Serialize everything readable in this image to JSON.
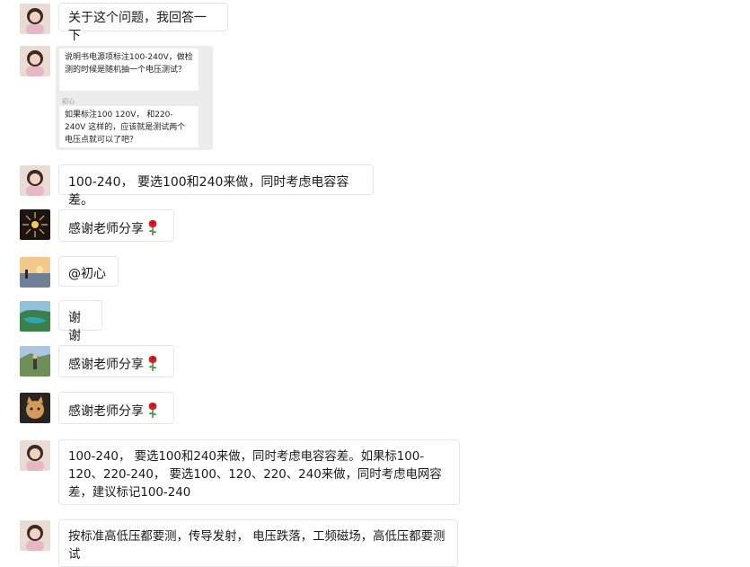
{
  "messages": [
    {
      "text": "关于这个问题，我回答一下"
    },
    {
      "quote": {
        "first": "说明书电源项标注100-240V，做检测的时候是随机抽一个电压测试？",
        "name": "初心",
        "second": "如果标注100 120V， 和220-240V 这样的，应该就是测试两个电压点就可以了吧？"
      }
    },
    {
      "text": "100-240， 要选100和240来做，同时考虑电容容差。"
    },
    {
      "text": "感谢老师分享"
    },
    {
      "text": "@初心"
    },
    {
      "text": "谢谢"
    },
    {
      "text": "感谢老师分享"
    },
    {
      "text": "感谢老师分享"
    },
    {
      "text": "100-240， 要选100和240来做，同时考虑电容容差。如果标100-120、220-240， 要选100、120、220、240来做，同时考虑电网容差，建议标记100-240"
    },
    {
      "text": "按标准高低压都要测，传导发射， 电压跌落，工频磁场，高低压都要测试"
    }
  ],
  "icons": {
    "rose": "rose-emoji-icon"
  },
  "colors": {
    "bubble_border": "#e6e6e6",
    "quote_bg": "#ececec",
    "rose": "#d6202a"
  }
}
